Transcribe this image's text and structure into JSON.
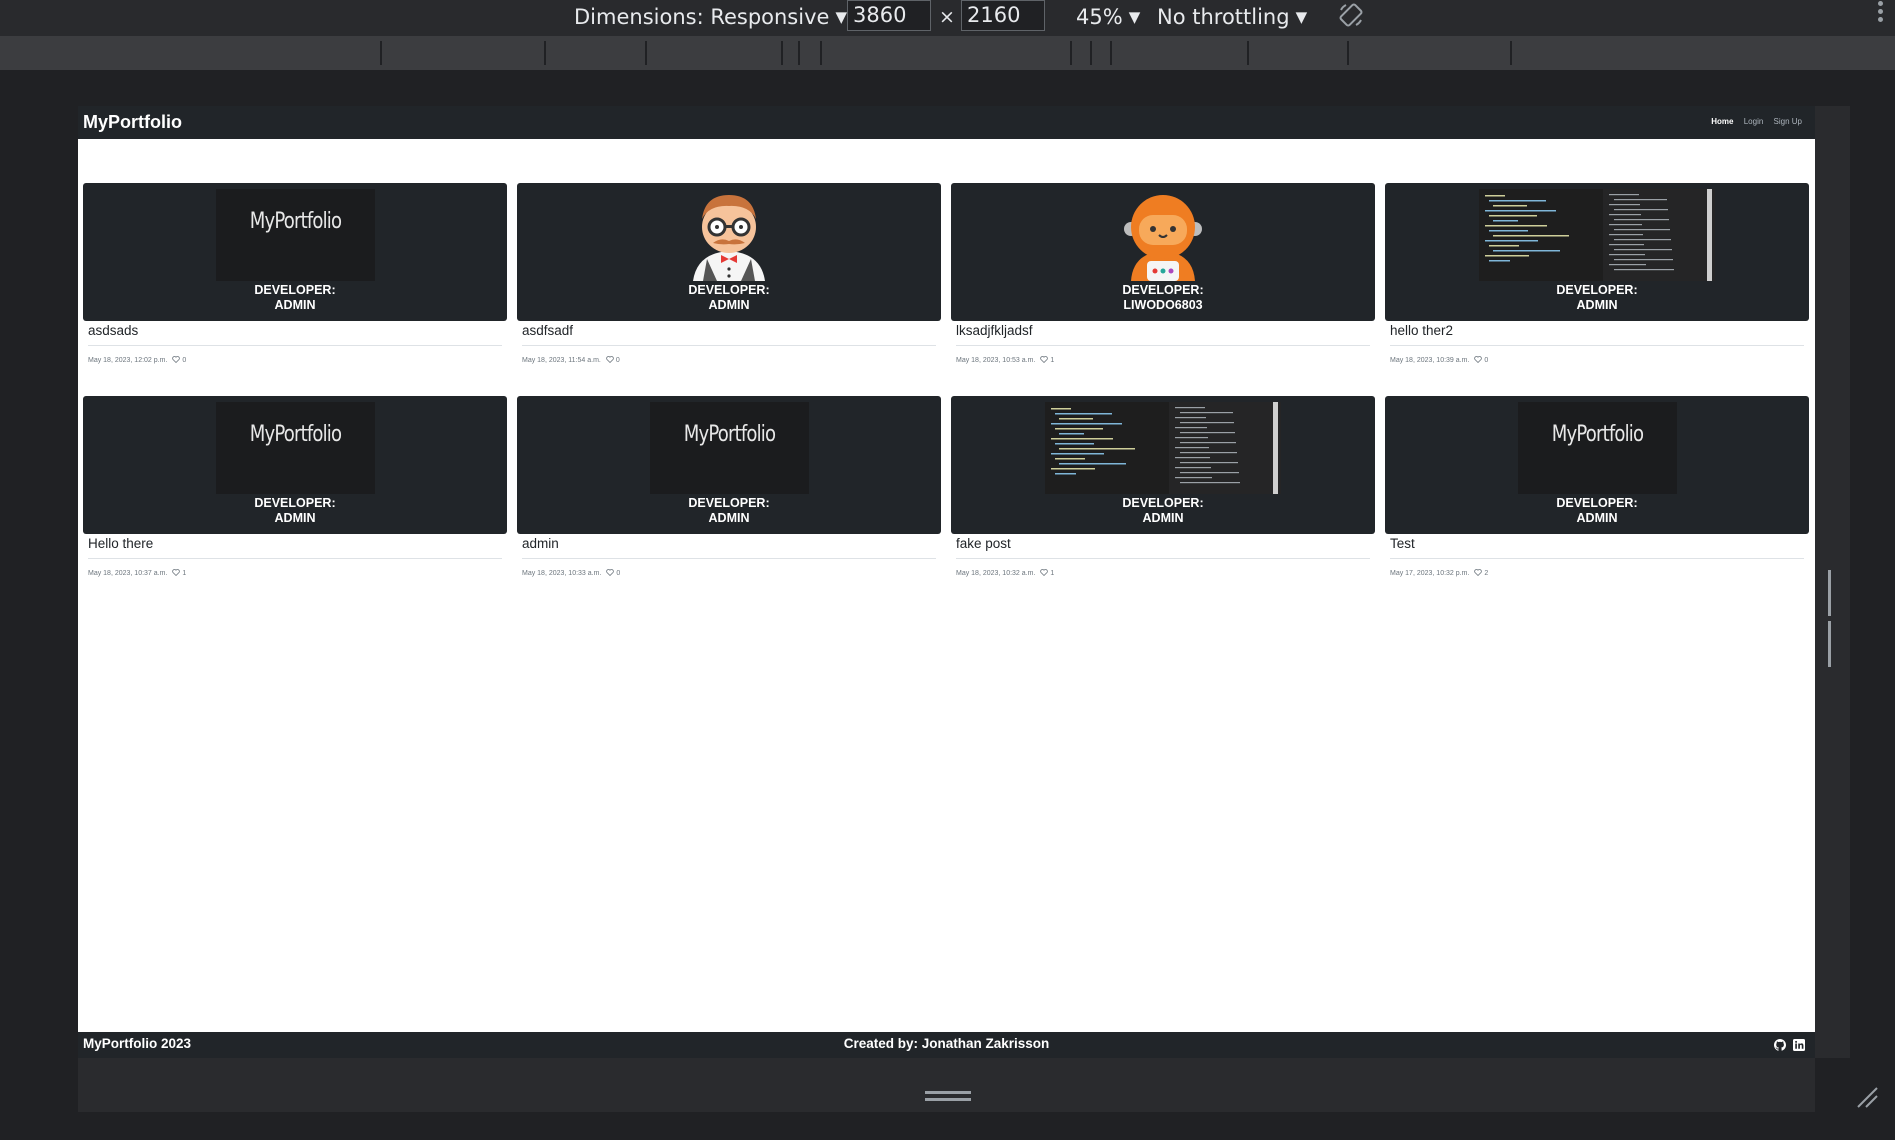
{
  "devtools": {
    "dimensions_label": "Dimensions: Responsive",
    "width_value": "3860",
    "times_symbol": "×",
    "height_value": "2160",
    "zoom": "45%",
    "throttling": "No throttling"
  },
  "site": {
    "brand": "MyPortfolio",
    "nav": [
      {
        "label": "Home",
        "active": true
      },
      {
        "label": "Login",
        "active": false
      },
      {
        "label": "Sign Up",
        "active": false
      }
    ],
    "posts": [
      {
        "title": "asdsads",
        "developer": "ADMIN",
        "date": "May 18, 2023, 12:02 p.m.",
        "likes": "0",
        "image": "logo",
        "logo_text": "MyPortfolio"
      },
      {
        "title": "asdfsadf",
        "developer": "ADMIN",
        "date": "May 18, 2023, 11:54 a.m.",
        "likes": "0",
        "image": "avatar-glasses"
      },
      {
        "title": "lksadjfkljadsf",
        "developer": "LIWODO6803",
        "date": "May 18, 2023, 10:53 a.m.",
        "likes": "1",
        "image": "avatar-astronaut"
      },
      {
        "title": "hello ther2",
        "developer": "ADMIN",
        "date": "May 18, 2023, 10:39 a.m.",
        "likes": "0",
        "image": "code"
      },
      {
        "title": "Hello there",
        "developer": "ADMIN",
        "date": "May 18, 2023, 10:37 a.m.",
        "likes": "1",
        "image": "logo",
        "logo_text": "MyPortfolio"
      },
      {
        "title": "admin",
        "developer": "ADMIN",
        "date": "May 18, 2023, 10:33 a.m.",
        "likes": "0",
        "image": "logo",
        "logo_text": "MyPortfolio"
      },
      {
        "title": "fake post",
        "developer": "ADMIN",
        "date": "May 18, 2023, 10:32 a.m.",
        "likes": "1",
        "image": "code"
      },
      {
        "title": "Test",
        "developer": "ADMIN",
        "date": "May 17, 2023, 10:32 p.m.",
        "likes": "2",
        "image": "logo",
        "logo_text": "MyPortfolio"
      }
    ],
    "developer_prefix": "DEVELOPER:",
    "footer": {
      "left": "MyPortfolio 2023",
      "center": "Created by: Jonathan Zakrisson"
    }
  },
  "colors": {
    "navbar": "#212529",
    "devtools_bg": "#202124",
    "page_bg": "#ffffff"
  }
}
